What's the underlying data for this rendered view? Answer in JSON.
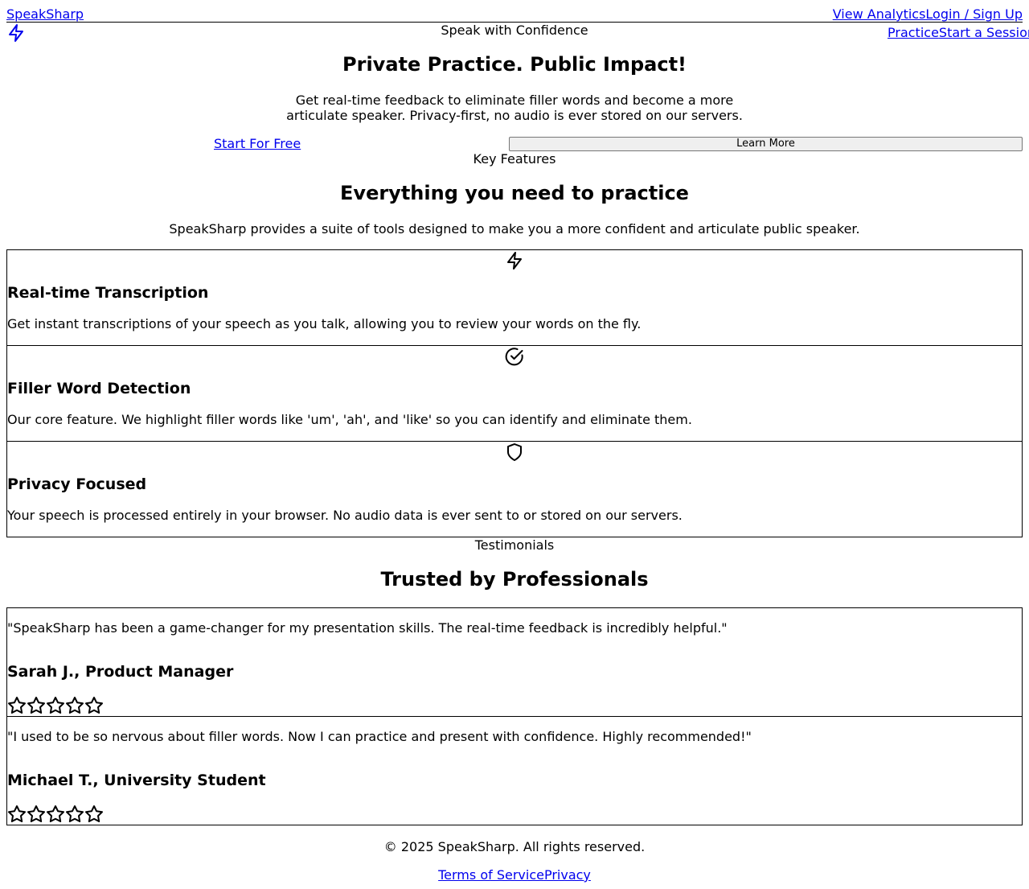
{
  "header": {
    "brand": "SpeakSharp",
    "nav_top": [
      "View Analytics",
      "Login / Sign Up"
    ],
    "nav_bottom": [
      "Practice",
      "Start a Session"
    ],
    "logo_icon": "lightning-bolt-icon"
  },
  "hero": {
    "eyebrow": "Speak with Confidence",
    "title": "Private Practice. Public Impact!",
    "description": "Get real-time feedback to eliminate filler words and become a more articulate speaker. Privacy-first, no audio is ever stored on our servers.",
    "primary_cta": "Start For Free",
    "secondary_cta": "Learn More"
  },
  "features": {
    "eyebrow": "Key Features",
    "title": "Everything you need to practice",
    "description": "SpeakSharp provides a suite of tools designed to make you a more confident and articulate public speaker.",
    "items": [
      {
        "icon": "lightning-bolt-icon",
        "title": "Real-time Transcription",
        "text": "Get instant transcriptions of your speech as you talk, allowing you to review your words on the fly."
      },
      {
        "icon": "check-circle-icon",
        "title": "Filler Word Detection",
        "text": "Our core feature. We highlight filler words like 'um', 'ah', and 'like' so you can identify and eliminate them."
      },
      {
        "icon": "shield-icon",
        "title": "Privacy Focused",
        "text": "Your speech is processed entirely in your browser. No audio data is ever sent to or stored on our servers."
      }
    ]
  },
  "testimonials": {
    "eyebrow": "Testimonials",
    "title": "Trusted by Professionals",
    "items": [
      {
        "quote": "\"SpeakSharp has been a game-changer for my presentation skills. The real-time feedback is incredibly helpful.\"",
        "author": "Sarah J., Product Manager",
        "rating_icon": "star-outline-icon"
      },
      {
        "quote": "\"I used to be so nervous about filler words. Now I can practice and present with confidence. Highly recommended!\"",
        "author": "Michael T., University Student",
        "rating_icon": "star-outline-icon"
      }
    ]
  },
  "footer": {
    "copyright": "© 2025 SpeakSharp. All rights reserved.",
    "links": [
      "Terms of Service",
      "Privacy"
    ]
  }
}
